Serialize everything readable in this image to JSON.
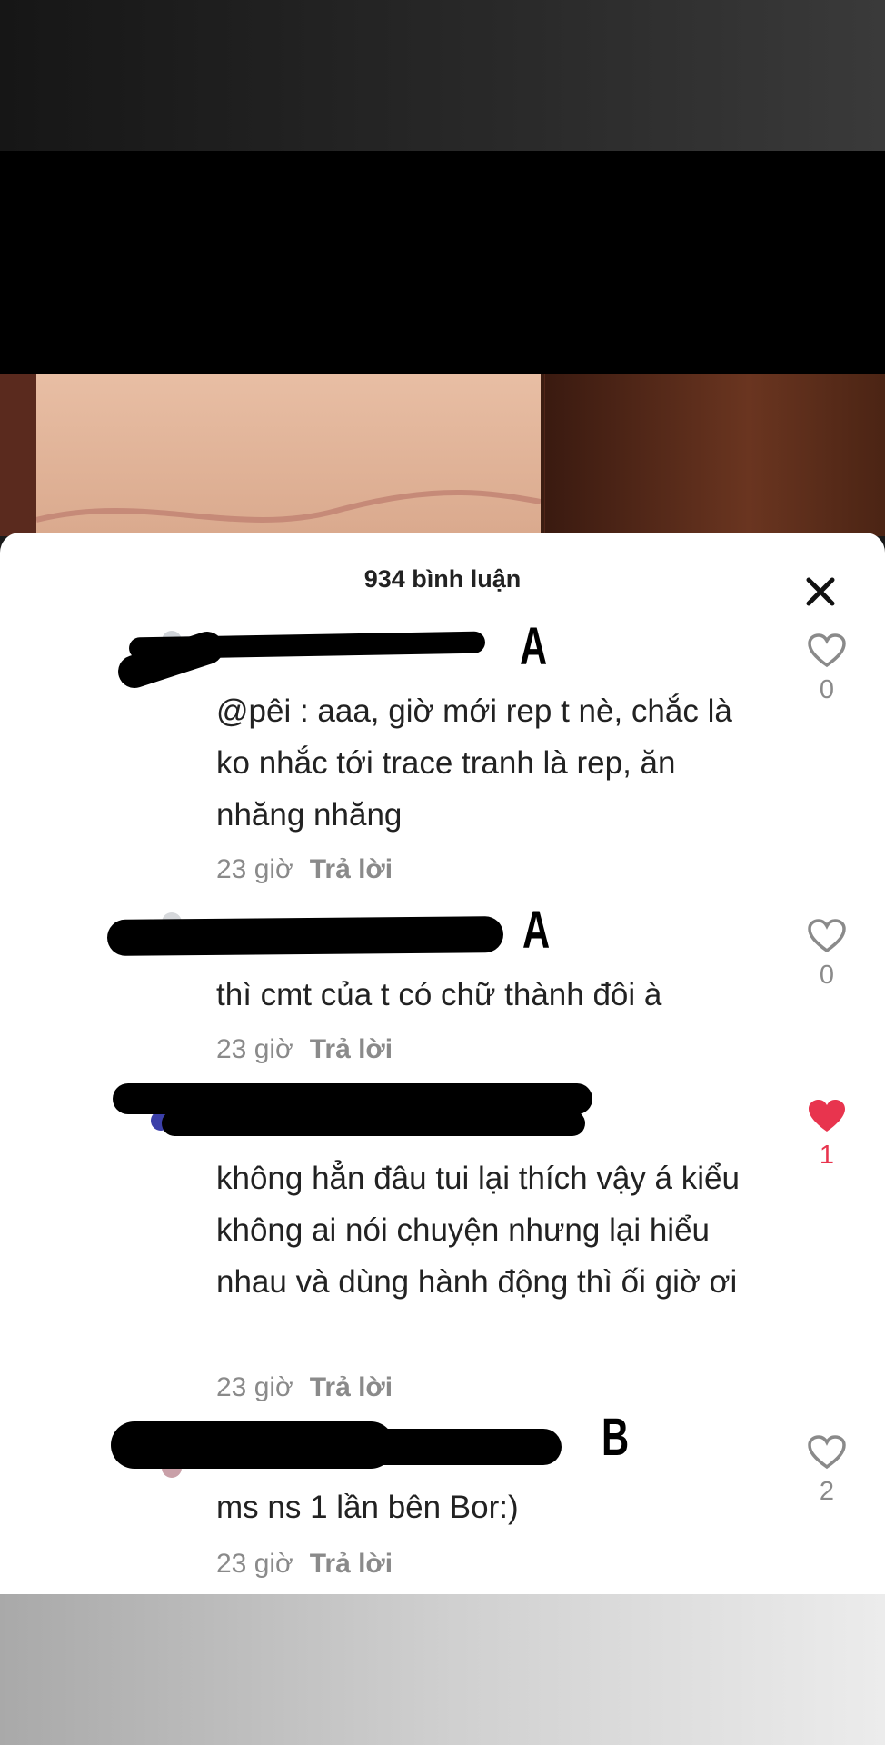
{
  "comments_sheet": {
    "title": "934 bình luận",
    "close_icon": "close-icon"
  },
  "comments": [
    {
      "marker": "A",
      "text": "@pêi :  aaa, giờ mới rep t nè, chắc là ko nhắc tới trace tranh là rep, ăn nhăng nhăng",
      "time": "23 giờ",
      "reply_label": "Trả lời",
      "likes": "0",
      "liked": false
    },
    {
      "marker": "A",
      "text": "thì cmt của t có chữ thành đôi à",
      "time": "23 giờ",
      "reply_label": "Trả lời",
      "likes": "0",
      "liked": false
    },
    {
      "marker": "",
      "text": "không hẳn đâu tui lại thích vậy á kiểu không ai nói chuyện nhưng lại hiểu nhau và dùng hành động thì ối giờ ơi",
      "time": "23 giờ",
      "reply_label": "Trả lời",
      "likes": "1",
      "liked": true
    },
    {
      "marker": "B",
      "text": "ms ns 1 lần bên Bor:)",
      "time": "23 giờ",
      "reply_label": "Trả lời",
      "likes": "2",
      "liked": false
    }
  ],
  "colors": {
    "like_active": "#e8344e",
    "muted_text": "#8a8a8a",
    "body_text": "#222222"
  }
}
